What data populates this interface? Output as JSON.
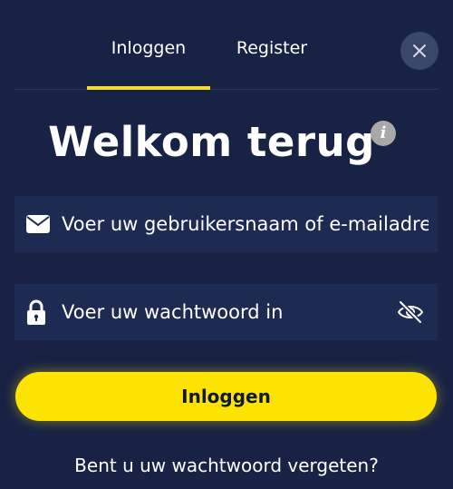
{
  "tabs": {
    "login_label": "Inloggen",
    "register_label": "Register"
  },
  "title": "Welkom terug",
  "info_glyph": "i",
  "form": {
    "username_placeholder": "Voer uw gebruikersnaam of e-mailadres in",
    "password_placeholder": "Voer uw wachtwoord in",
    "submit_label": "Inloggen",
    "forgot_label": "Bent u uw wachtwoord vergeten?"
  },
  "colors": {
    "background": "#172244",
    "field_background": "#1d2a52",
    "accent": "#fde302"
  },
  "icons": {
    "close": "close-icon",
    "info": "info-icon",
    "username": "envelope-icon",
    "password": "lock-icon",
    "toggle_visibility": "eye-slash-icon"
  }
}
